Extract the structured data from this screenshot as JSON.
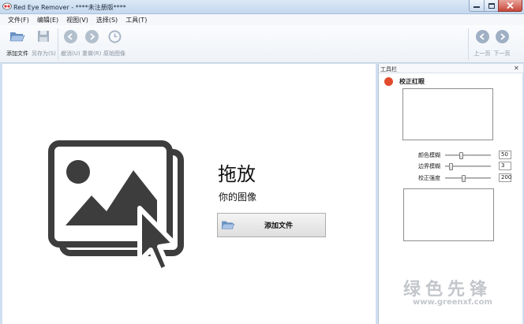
{
  "window": {
    "title": "Red Eye Remover - ****未注册版****",
    "controls": [
      "minimize-icon",
      "maximize-icon",
      "close-icon"
    ]
  },
  "menu": [
    "文件(F)",
    "编辑(E)",
    "视图(V)",
    "选择(S)",
    "工具(T)"
  ],
  "toolbar": {
    "add_file": "添加文件",
    "save_as": "另存为(S)",
    "undo": "撤消(U)",
    "redo": "重做(R)",
    "original": "原始图像",
    "prev": "上一页",
    "next": "下一页"
  },
  "drop_zone": {
    "title": "拖放",
    "subtitle": "你的图像",
    "button": "添加文件"
  },
  "panel": {
    "title": "工具栏",
    "section": "校正红眼",
    "sliders": [
      {
        "label": "颜色模糊",
        "value": "50",
        "level": 0.35
      },
      {
        "label": "边界模糊",
        "value": "3",
        "level": 0.12
      },
      {
        "label": "校正强度",
        "value": "200",
        "level": 0.4
      }
    ]
  },
  "watermark": {
    "text": "绿色先锋",
    "url": "www.greenxf.com"
  },
  "colors": {
    "title_bar": "#c5d8ee",
    "close_button": "#c8463a",
    "red_eye_icon": "#e24a2c",
    "illustration": "#3d3d3d"
  }
}
